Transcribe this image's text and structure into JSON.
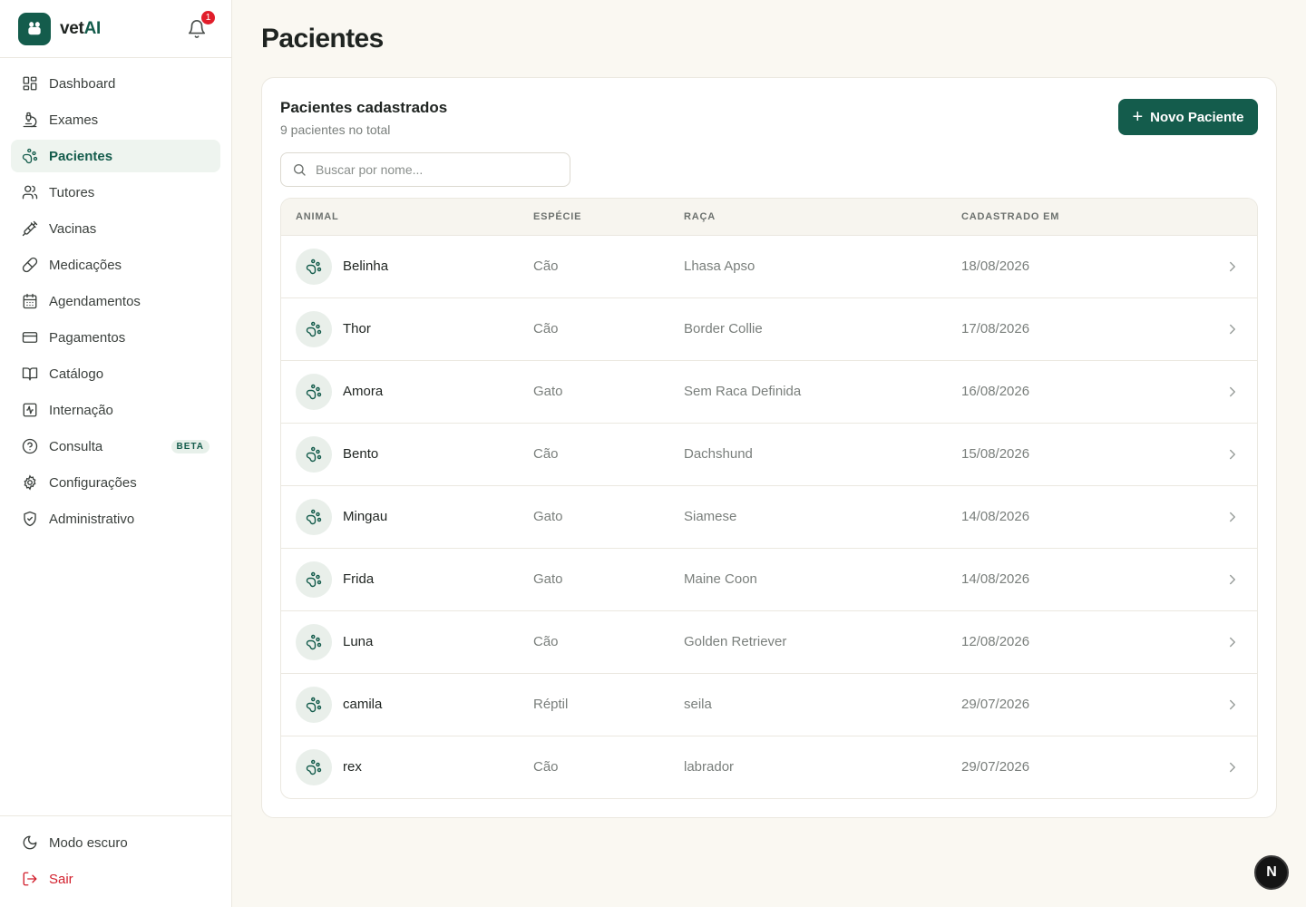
{
  "brand": {
    "name_prefix": "vet",
    "name_suffix": "AI",
    "logo_icon": "paw-icon"
  },
  "notifications": {
    "count": "1",
    "icon": "bell-icon"
  },
  "sidebar": {
    "items": [
      {
        "label": "Dashboard",
        "icon": "dashboard-icon",
        "active": false
      },
      {
        "label": "Exames",
        "icon": "microscope-icon",
        "active": false
      },
      {
        "label": "Pacientes",
        "icon": "paw-icon",
        "active": true
      },
      {
        "label": "Tutores",
        "icon": "users-icon",
        "active": false
      },
      {
        "label": "Vacinas",
        "icon": "syringe-icon",
        "active": false
      },
      {
        "label": "Medicações",
        "icon": "pill-icon",
        "active": false
      },
      {
        "label": "Agendamentos",
        "icon": "calendar-icon",
        "active": false
      },
      {
        "label": "Pagamentos",
        "icon": "credit-card-icon",
        "active": false
      },
      {
        "label": "Catálogo",
        "icon": "book-icon",
        "active": false
      },
      {
        "label": "Internação",
        "icon": "activity-icon",
        "active": false
      },
      {
        "label": "Consulta",
        "icon": "help-circle-icon",
        "active": false,
        "badge": "BETA"
      },
      {
        "label": "Configurações",
        "icon": "gear-icon",
        "active": false
      },
      {
        "label": "Administrativo",
        "icon": "shield-icon",
        "active": false
      }
    ],
    "footer": {
      "dark_mode": "Modo escuro",
      "logout": "Sair"
    }
  },
  "page": {
    "title": "Pacientes"
  },
  "card": {
    "title": "Pacientes cadastrados",
    "subtitle": "9 pacientes no total",
    "new_button": "Novo Paciente",
    "search_placeholder": "Buscar por nome..."
  },
  "table": {
    "columns": {
      "animal": "ANIMAL",
      "species": "ESPÉCIE",
      "breed": "RAÇA",
      "registered": "CADASTRADO EM"
    },
    "rows": [
      {
        "name": "Belinha",
        "species": "Cão",
        "breed": "Lhasa Apso",
        "date": "18/08/2026"
      },
      {
        "name": "Thor",
        "species": "Cão",
        "breed": "Border Collie",
        "date": "17/08/2026"
      },
      {
        "name": "Amora",
        "species": "Gato",
        "breed": "Sem Raca Definida",
        "date": "16/08/2026"
      },
      {
        "name": "Bento",
        "species": "Cão",
        "breed": "Dachshund",
        "date": "15/08/2026"
      },
      {
        "name": "Mingau",
        "species": "Gato",
        "breed": "Siamese",
        "date": "14/08/2026"
      },
      {
        "name": "Frida",
        "species": "Gato",
        "breed": "Maine Coon",
        "date": "14/08/2026"
      },
      {
        "name": "Luna",
        "species": "Cão",
        "breed": "Golden Retriever",
        "date": "12/08/2026"
      },
      {
        "name": "camila",
        "species": "Réptil",
        "breed": "seila",
        "date": "29/07/2026"
      },
      {
        "name": "rex",
        "species": "Cão",
        "breed": "labrador",
        "date": "29/07/2026"
      }
    ]
  },
  "dev_badge": {
    "label": "N"
  },
  "colors": {
    "accent": "#145c4c",
    "danger": "#d21f2c",
    "background": "#faf8f2"
  }
}
